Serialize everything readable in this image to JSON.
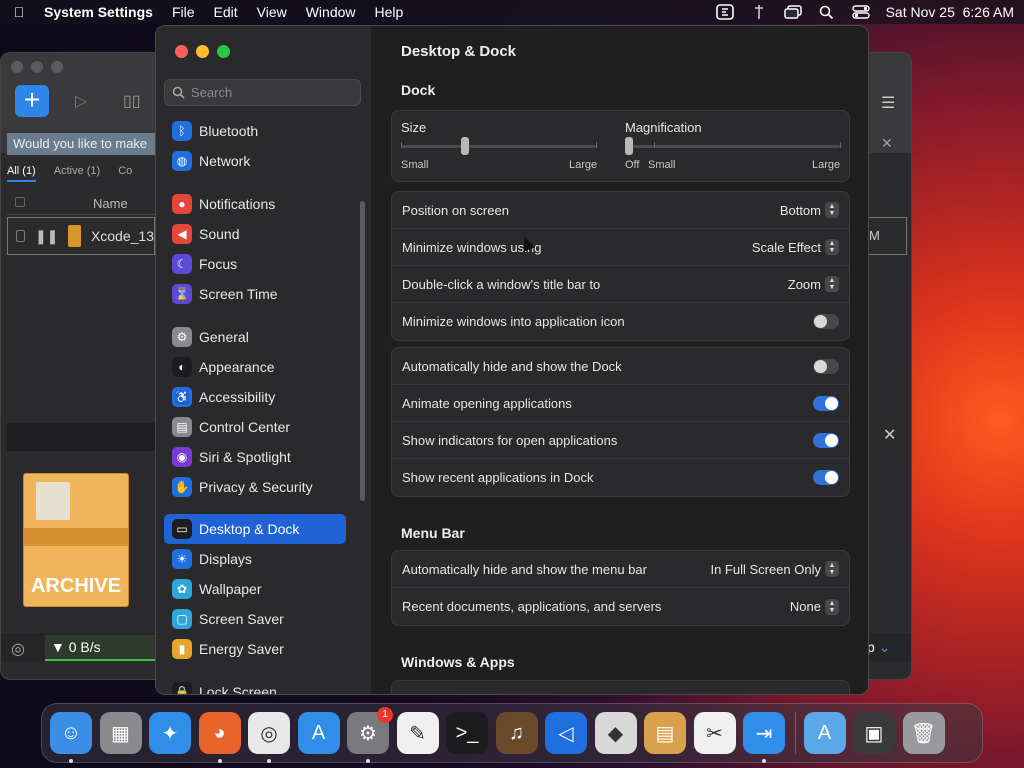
{
  "menubar": {
    "app_name": "System Settings",
    "items": [
      "File",
      "Edit",
      "View",
      "Window",
      "Help"
    ],
    "datetime": "Sat Nov 25  6:26 AM"
  },
  "background_app": {
    "notice": "Would you like to make",
    "tabs": [
      "All (1)",
      "Active (1)",
      "Co"
    ],
    "column_name": "Name",
    "row_name": "Xcode_13",
    "row_right": "M",
    "archive_label": "ARCHIVE",
    "speed": "▼ 0 B/s",
    "partial_right": "p"
  },
  "sidebar": {
    "search_placeholder": "Search",
    "groups": [
      [
        {
          "label": "Bluetooth",
          "icon": "bluetooth-icon",
          "color": "#1f6fe0",
          "glyph": "ᛒ"
        },
        {
          "label": "Network",
          "icon": "globe-icon",
          "color": "#1f6fe0",
          "glyph": "◍"
        }
      ],
      [
        {
          "label": "Notifications",
          "icon": "bell-icon",
          "color": "#e8453c",
          "glyph": "●"
        },
        {
          "label": "Sound",
          "icon": "speaker-icon",
          "color": "#e8453c",
          "glyph": "◀"
        },
        {
          "label": "Focus",
          "icon": "moon-icon",
          "color": "#5b4ad6",
          "glyph": "☾"
        },
        {
          "label": "Screen Time",
          "icon": "hourglass-icon",
          "color": "#5b4ad6",
          "glyph": "⌛"
        }
      ],
      [
        {
          "label": "General",
          "icon": "gear-icon",
          "color": "#8a8a8e",
          "glyph": "⚙"
        },
        {
          "label": "Appearance",
          "icon": "appearance-icon",
          "color": "#1c1c1e",
          "glyph": "◐"
        },
        {
          "label": "Accessibility",
          "icon": "accessibility-icon",
          "color": "#1f6fe0",
          "glyph": "♿"
        },
        {
          "label": "Control Center",
          "icon": "control-center-icon",
          "color": "#8a8a8e",
          "glyph": "▤"
        },
        {
          "label": "Siri & Spotlight",
          "icon": "siri-icon",
          "color": "#7a3ad6",
          "glyph": "◉"
        },
        {
          "label": "Privacy & Security",
          "icon": "hand-icon",
          "color": "#1f6fe0",
          "glyph": "✋"
        }
      ],
      [
        {
          "label": "Desktop & Dock",
          "icon": "dock-icon",
          "color": "#1c1c1e",
          "glyph": "▭",
          "selected": true
        },
        {
          "label": "Displays",
          "icon": "sun-icon",
          "color": "#1f6fe0",
          "glyph": "☀"
        },
        {
          "label": "Wallpaper",
          "icon": "wallpaper-icon",
          "color": "#2fa6d8",
          "glyph": "✿"
        },
        {
          "label": "Screen Saver",
          "icon": "screen-saver-icon",
          "color": "#2fa6d8",
          "glyph": "▢"
        },
        {
          "label": "Energy Saver",
          "icon": "battery-icon",
          "color": "#e8a52c",
          "glyph": "▮"
        }
      ],
      [
        {
          "label": "Lock Screen",
          "icon": "lock-icon",
          "color": "#1c1c1e",
          "glyph": "🔒"
        }
      ]
    ]
  },
  "content": {
    "title": "Desktop & Dock",
    "dock_section": "Dock",
    "size": {
      "label": "Size",
      "min": "Small",
      "max": "Large",
      "value": 0.33
    },
    "magnification": {
      "label": "Magnification",
      "off": "Off",
      "min": "Small",
      "max": "Large",
      "value": 0.0
    },
    "dock_settings": [
      {
        "label": "Position on screen",
        "value": "Bottom",
        "type": "popup"
      },
      {
        "label": "Minimize windows using",
        "value": "Scale Effect",
        "type": "popup"
      },
      {
        "label": "Double-click a window's title bar to",
        "value": "Zoom",
        "type": "popup"
      },
      {
        "label": "Minimize windows into application icon",
        "on": false,
        "type": "toggle"
      }
    ],
    "dock_behavior": [
      {
        "label": "Automatically hide and show the Dock",
        "on": false
      },
      {
        "label": "Animate opening applications",
        "on": true
      },
      {
        "label": "Show indicators for open applications",
        "on": true
      },
      {
        "label": "Show recent applications in Dock",
        "on": true
      }
    ],
    "menubar_section": "Menu Bar",
    "menubar_settings": [
      {
        "label": "Automatically hide and show the menu bar",
        "value": "In Full Screen Only"
      },
      {
        "label": "Recent documents, applications, and servers",
        "value": "None"
      }
    ],
    "windows_section": "Windows & Apps"
  },
  "dock": {
    "apps": [
      {
        "name": "finder-icon",
        "color": "#3a8ee6",
        "glyph": "☺",
        "running": true
      },
      {
        "name": "launchpad-icon",
        "color": "#8a8a8e",
        "glyph": "▦",
        "running": false
      },
      {
        "name": "safari-icon",
        "color": "#2f8fe8",
        "glyph": "✦",
        "running": false
      },
      {
        "name": "firefox-icon",
        "color": "#e8622c",
        "glyph": "◕",
        "running": true
      },
      {
        "name": "chrome-icon",
        "color": "#e8e8e8",
        "glyph": "◎",
        "running": true
      },
      {
        "name": "app-store-icon",
        "color": "#2f8fe8",
        "glyph": "A",
        "running": false
      },
      {
        "name": "system-settings-icon",
        "color": "#7a7a7e",
        "glyph": "⚙",
        "running": true,
        "badge": "1"
      },
      {
        "name": "textedit-icon",
        "color": "#f0f0f0",
        "glyph": "✎",
        "running": false
      },
      {
        "name": "terminal-icon",
        "color": "#1c1c1e",
        "glyph": ">_",
        "running": false
      },
      {
        "name": "instruments-icon",
        "color": "#6a4a2a",
        "glyph": "♫",
        "running": false
      },
      {
        "name": "vscode-icon",
        "color": "#1f6fe0",
        "glyph": "◁",
        "running": false
      },
      {
        "name": "roblox-icon",
        "color": "#d8d8d8",
        "glyph": "◆",
        "running": false
      },
      {
        "name": "archive-utility-icon",
        "color": "#d8a24c",
        "glyph": "▤",
        "running": false
      },
      {
        "name": "capcut-icon",
        "color": "#f0f0f0",
        "glyph": "✂",
        "running": false
      },
      {
        "name": "transmit-icon",
        "color": "#2f8fe8",
        "glyph": "⇥",
        "running": true
      }
    ],
    "others": [
      {
        "name": "applications-folder-icon",
        "color": "#5aa8e8",
        "glyph": "A"
      },
      {
        "name": "downloads-stack-icon",
        "color": "#3a3a3c",
        "glyph": "▣"
      },
      {
        "name": "trash-icon",
        "color": "#9a9a9e",
        "glyph": "🗑"
      }
    ]
  }
}
